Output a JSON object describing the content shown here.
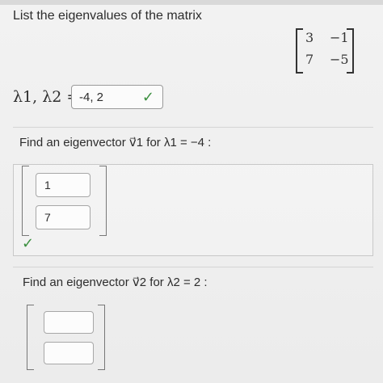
{
  "question": {
    "title": "List the eigenvalues of the matrix",
    "matrix": {
      "row1col1": "3",
      "row1col2": "−1",
      "row2col1": "7",
      "row2col2": "−5"
    },
    "eigenvalues": {
      "label": "λ1, λ2 =",
      "value": "-4, 2",
      "status_icon": "check-icon"
    }
  },
  "section1": {
    "title": "Find an eigenvector v⃗1 for λ1 = −4 :",
    "values": {
      "first": "1",
      "second": "7"
    },
    "status_icon": "check-icon"
  },
  "section2": {
    "title": "Find an eigenvector v⃗2 for λ2 = 2 :",
    "values": {
      "first": "",
      "second": ""
    }
  },
  "icons": {
    "check": "✓"
  },
  "colors": {
    "success": "#3b8f3f"
  }
}
